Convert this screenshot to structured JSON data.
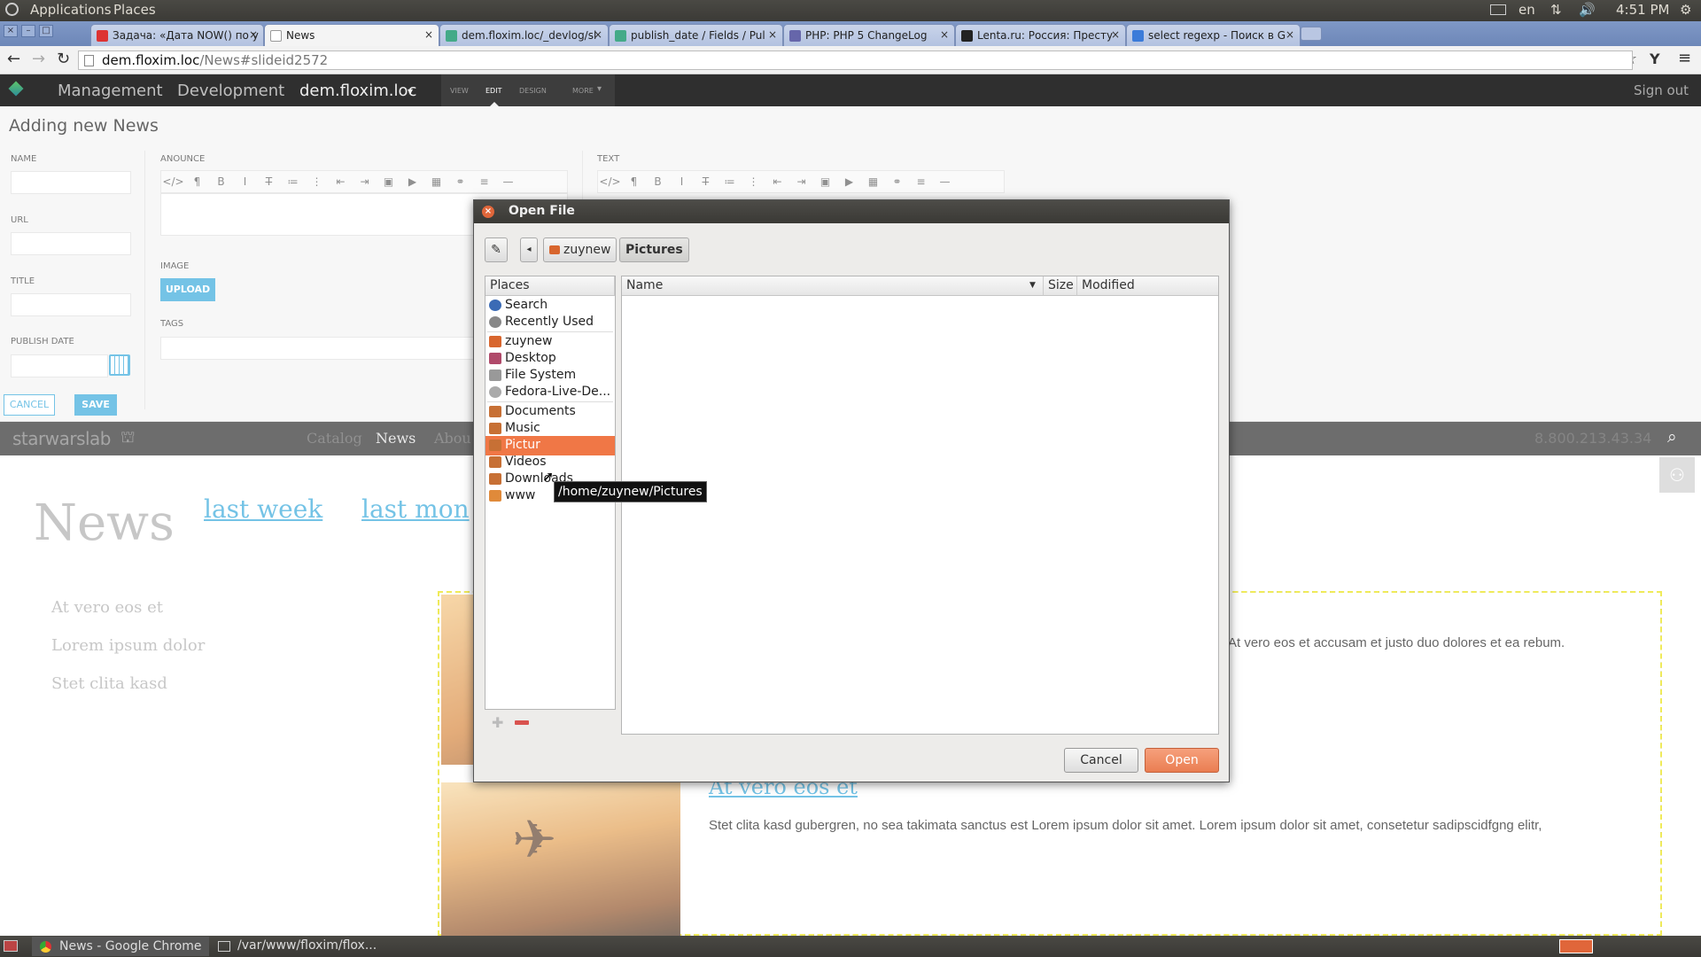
{
  "top_panel": {
    "applications": "Applications",
    "places": "Places",
    "keyboard_layout": "en",
    "time": "4:51 PM"
  },
  "tabs": [
    {
      "label": "Задача: «Дата NOW() по у",
      "color": "#d33"
    },
    {
      "label": "News",
      "color": "#fff"
    },
    {
      "label": "dem.floxim.loc/_devlog/sl",
      "color": "#4a8"
    },
    {
      "label": "publish_date / Fields / Pul",
      "color": "#4a8"
    },
    {
      "label": "PHP: PHP 5 ChangeLog",
      "color": "#66a"
    },
    {
      "label": "Lenta.ru: Россия: Престу",
      "color": "#222"
    },
    {
      "label": "select regexp - Поиск в G",
      "color": "#3b7bd9"
    }
  ],
  "address": {
    "host": "dem.floxim.loc",
    "path": "/News#slideid2572"
  },
  "admin": {
    "management": "Management",
    "development": "Development",
    "site": "dem.floxim.loc",
    "modes": [
      "VIEW",
      "EDIT",
      "DESIGN",
      "MORE"
    ],
    "sign_out": "Sign out"
  },
  "editor": {
    "title": "Adding new News",
    "labels": {
      "name": "NAME",
      "url": "URL",
      "title": "TITLE",
      "publish_date": "PUBLISH DATE",
      "announce": "ANOUNCE",
      "image": "IMAGE",
      "tags": "TAGS",
      "text": "TEXT"
    },
    "upload": "UPLOAD",
    "cancel": "CANCEL",
    "save": "SAVE",
    "toolbar": [
      "</>",
      "¶",
      "B",
      "I",
      "T̶",
      "≔",
      "⋮",
      "⇤",
      "⇥",
      "▣",
      "▶",
      "▦",
      "⚭",
      "≡",
      "—"
    ]
  },
  "site": {
    "logo": "starwarslab",
    "nav": [
      "Catalog",
      "News",
      "Abou"
    ],
    "phone": "8.800.213.43.34",
    "heading": "News",
    "filters": [
      "last week",
      "last mon"
    ],
    "sidebar": [
      "At vero eos et",
      "Lorem ipsum dolor",
      "Stet clita kasd"
    ],
    "article1_text": "At vero eos et accusam et justo duo dolores et ea rebum.",
    "article2_title": "At vero eos et",
    "article2_text": "Stet clita kasd gubergren, no sea takimata sanctus est Lorem ipsum dolor sit amet. Lorem ipsum dolor sit amet, consetetur sadipscidfgng elitr,"
  },
  "dialog": {
    "title": "Open File",
    "path": [
      "zuynew",
      "Pictures"
    ],
    "places_header": "Places",
    "places": [
      {
        "label": "Search",
        "color": "#3b6bb5"
      },
      {
        "label": "Recently Used",
        "color": "#888"
      },
      {
        "label": "zuynew",
        "color": "#d8662e"
      },
      {
        "label": "Desktop",
        "color": "#b04a6a"
      },
      {
        "label": "File System",
        "color": "#999"
      },
      {
        "label": "Fedora-Live-De...",
        "color": "#aaa"
      },
      {
        "label": "Documents",
        "color": "#c77035"
      },
      {
        "label": "Music",
        "color": "#c77035"
      },
      {
        "label": "Pictures",
        "color": "#c77035"
      },
      {
        "label": "Videos",
        "color": "#c77035"
      },
      {
        "label": "Downloads",
        "color": "#c77035"
      },
      {
        "label": "www",
        "color": "#e08a3a"
      }
    ],
    "places_selected": "Pictur",
    "tooltip": "/home/zuynew/Pictures",
    "columns": {
      "name": "Name",
      "size": "Size",
      "modified": "Modified"
    },
    "cancel": "Cancel",
    "open": "Open"
  },
  "taskbar": [
    "News - Google Chrome",
    "/var/www/floxim/flox..."
  ]
}
